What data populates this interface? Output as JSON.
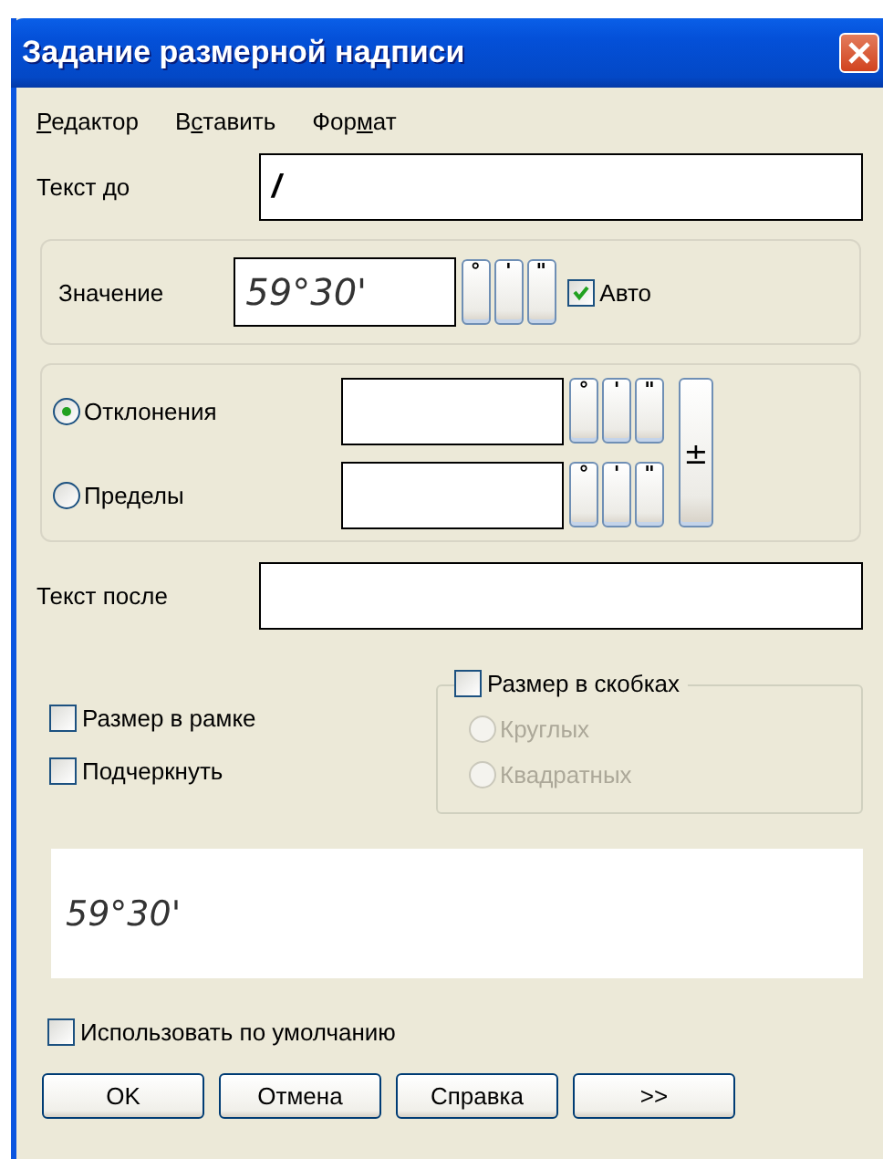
{
  "window": {
    "title": "Задание размерной надписи"
  },
  "menu": [
    {
      "key": "Р",
      "after": "едактор"
    },
    {
      "before": "В",
      "key": "с",
      "after": "тавить"
    },
    {
      "before": "Фор",
      "key": "м",
      "after": "ат"
    }
  ],
  "text_before": {
    "label": "Текст до",
    "value": "/"
  },
  "value": {
    "label": "Значение",
    "value": "59°30'",
    "symbols": [
      "°",
      "'",
      "\""
    ],
    "auto": {
      "label": "Авто",
      "checked": true
    }
  },
  "tolerance": {
    "options": [
      {
        "label": "Отклонения",
        "selected": true,
        "symbols": [
          "°",
          "'",
          "\""
        ]
      },
      {
        "label": "Пределы",
        "selected": false,
        "symbols": [
          "°",
          "'",
          "\""
        ]
      }
    ],
    "plusminus": "±"
  },
  "text_after": {
    "label": "Текст после"
  },
  "frame": {
    "label": "Размер в рамке",
    "checked": false
  },
  "underline": {
    "label": "Подчеркнуть",
    "checked": false
  },
  "brackets": {
    "label": "Размер в скобках",
    "checked": false,
    "options": [
      {
        "label": "Круглых",
        "selected": false,
        "disabled": true
      },
      {
        "label": "Квадратных",
        "selected": false,
        "disabled": true
      }
    ]
  },
  "preview": {
    "text": "59°30'"
  },
  "use_default": {
    "label": "Использовать по умолчанию",
    "checked": false
  },
  "buttons": [
    "OK",
    "Отмена",
    "Справка",
    ">>"
  ]
}
